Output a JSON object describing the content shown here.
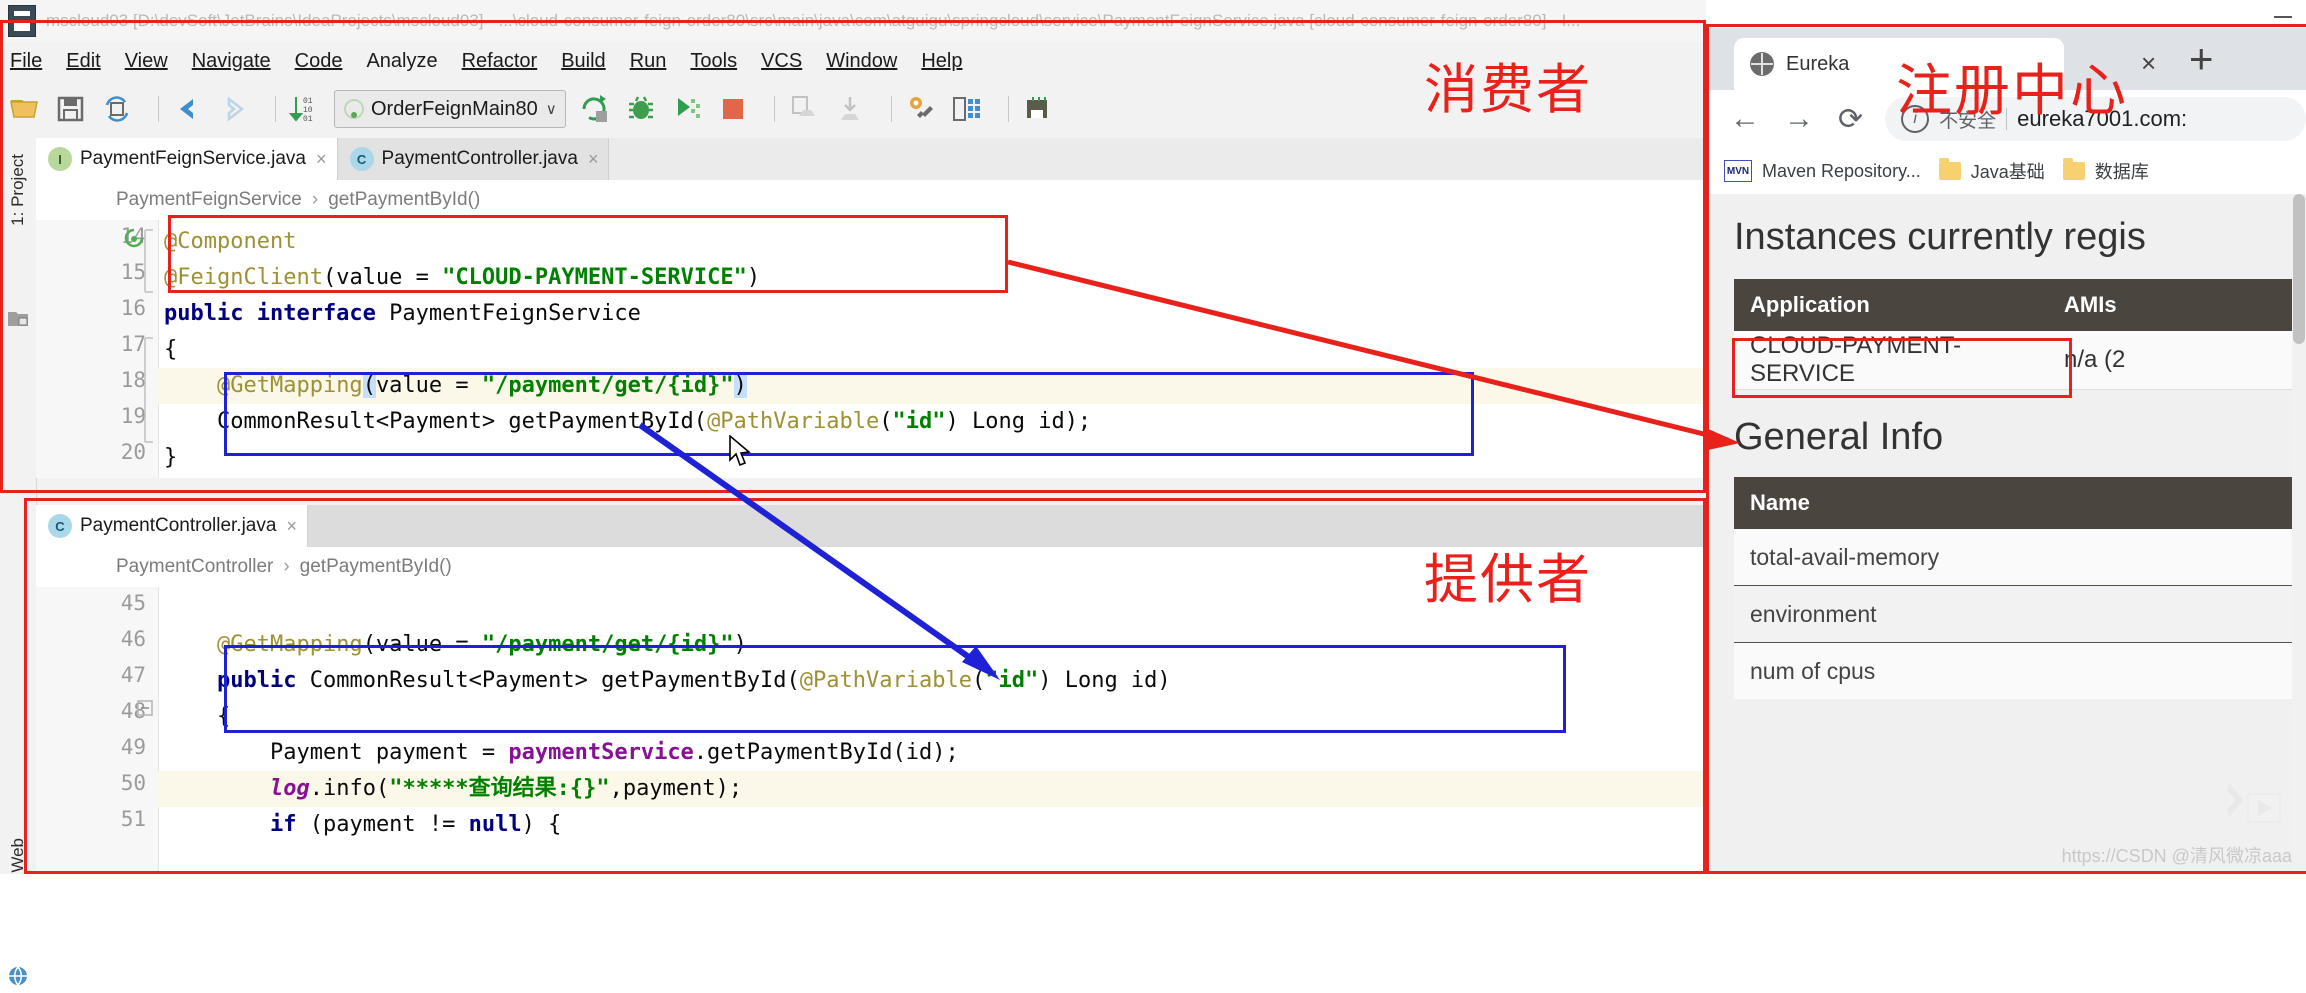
{
  "ide": {
    "title": "mscloud03 [D:\\devSoft\\JetBrains\\IdeaProjects\\mscloud03] - ...\\cloud-consumer-feign-order80\\src\\main\\java\\com\\atguigu\\springcloud\\service\\PaymentFeignService.java [cloud-consumer-feign-order80] - I...",
    "menu": [
      "File",
      "Edit",
      "View",
      "Navigate",
      "Code",
      "Analyze",
      "Refactor",
      "Build",
      "Run",
      "Tools",
      "VCS",
      "Window",
      "Help"
    ],
    "toolbar": {
      "run_config": "OrderFeignMain80",
      "chevron": "∨",
      "icons": [
        "open-folder-icon",
        "save-all-icon",
        "sync-icon",
        "back-arrow-icon",
        "forward-arrow-icon",
        "sort-icon",
        "run-icon",
        "debug-icon",
        "run-coverage-icon",
        "stop-icon",
        "update-project-icon",
        "commit-icon",
        "settings-icon",
        "project-structure-icon",
        "hardware-icon"
      ]
    },
    "left_strip": {
      "project_label": "1: Project",
      "web_label": "Web"
    },
    "top_editor": {
      "tabs": [
        {
          "label": "PaymentFeignService.java",
          "badge": "I",
          "kind": "interface",
          "active": true,
          "close": "×"
        },
        {
          "label": "PaymentController.java",
          "badge": "C",
          "kind": "class",
          "active": false,
          "close": "×"
        }
      ],
      "breadcrumb": {
        "class": "PaymentFeignService",
        "sep": "›",
        "method": "getPaymentById()"
      },
      "line_numbers": [
        "14",
        "15",
        "16",
        "17",
        "18",
        "19",
        "20"
      ],
      "lines": [
        "@Component",
        "@FeignClient(value = \"CLOUD-PAYMENT-SERVICE\")",
        "public interface PaymentFeignService",
        "{",
        "    @GetMapping(value = \"/payment/get/{id}\")",
        "    CommonResult<Payment> getPaymentById(@PathVariable(\"id\") Long id);",
        "}"
      ]
    },
    "bottom_editor": {
      "tabs": [
        {
          "label": "PaymentController.java",
          "badge": "C",
          "kind": "class",
          "active": true,
          "close": "×"
        }
      ],
      "breadcrumb": {
        "class": "PaymentController",
        "sep": "›",
        "method": "getPaymentById()"
      },
      "line_numbers": [
        "45",
        "46",
        "47",
        "48",
        "49",
        "50",
        "51"
      ],
      "lines": [
        "",
        "    @GetMapping(value = \"/payment/get/{id}\")",
        "    public CommonResult<Payment> getPaymentById(@PathVariable(\"id\") Long id)",
        "    {",
        "        Payment payment = paymentService.getPaymentById(id);",
        "        log.info(\"*****查询结果:{}\",payment);",
        "        if (payment != null) {"
      ]
    }
  },
  "annotations": {
    "consumer_label": "消费者",
    "provider_label": "提供者",
    "registry_label": "注册中心",
    "red": "#e8211b",
    "blue": "#1f21d6"
  },
  "browser": {
    "tab_title": "Eureka",
    "tab_close": "×",
    "new_tab": "+",
    "nav": {
      "back": "←",
      "forward": "→",
      "reload": "⟳"
    },
    "omnibox": {
      "info_glyph": "i",
      "security_text": "不安全",
      "url": "eureka7001.com:"
    },
    "bookmarks": [
      {
        "label": "Maven Repository...",
        "icon": "mvn-icon"
      },
      {
        "label": "Java基础",
        "icon": "folder-icon"
      },
      {
        "label": "数据库",
        "icon": "folder-icon"
      }
    ],
    "page": {
      "instances_heading": "Instances currently regis",
      "instances_table": {
        "headers": [
          "Application",
          "AMIs"
        ],
        "rows": [
          [
            "CLOUD-PAYMENT-SERVICE",
            "n/a (2"
          ]
        ]
      },
      "general_info_heading": "General Info",
      "general_info_table": {
        "headers": [
          "Name"
        ],
        "rows": [
          "total-avail-memory",
          "environment",
          "num of cpus"
        ]
      }
    },
    "watermark": "https://CSDN @清风微凉aaa"
  }
}
